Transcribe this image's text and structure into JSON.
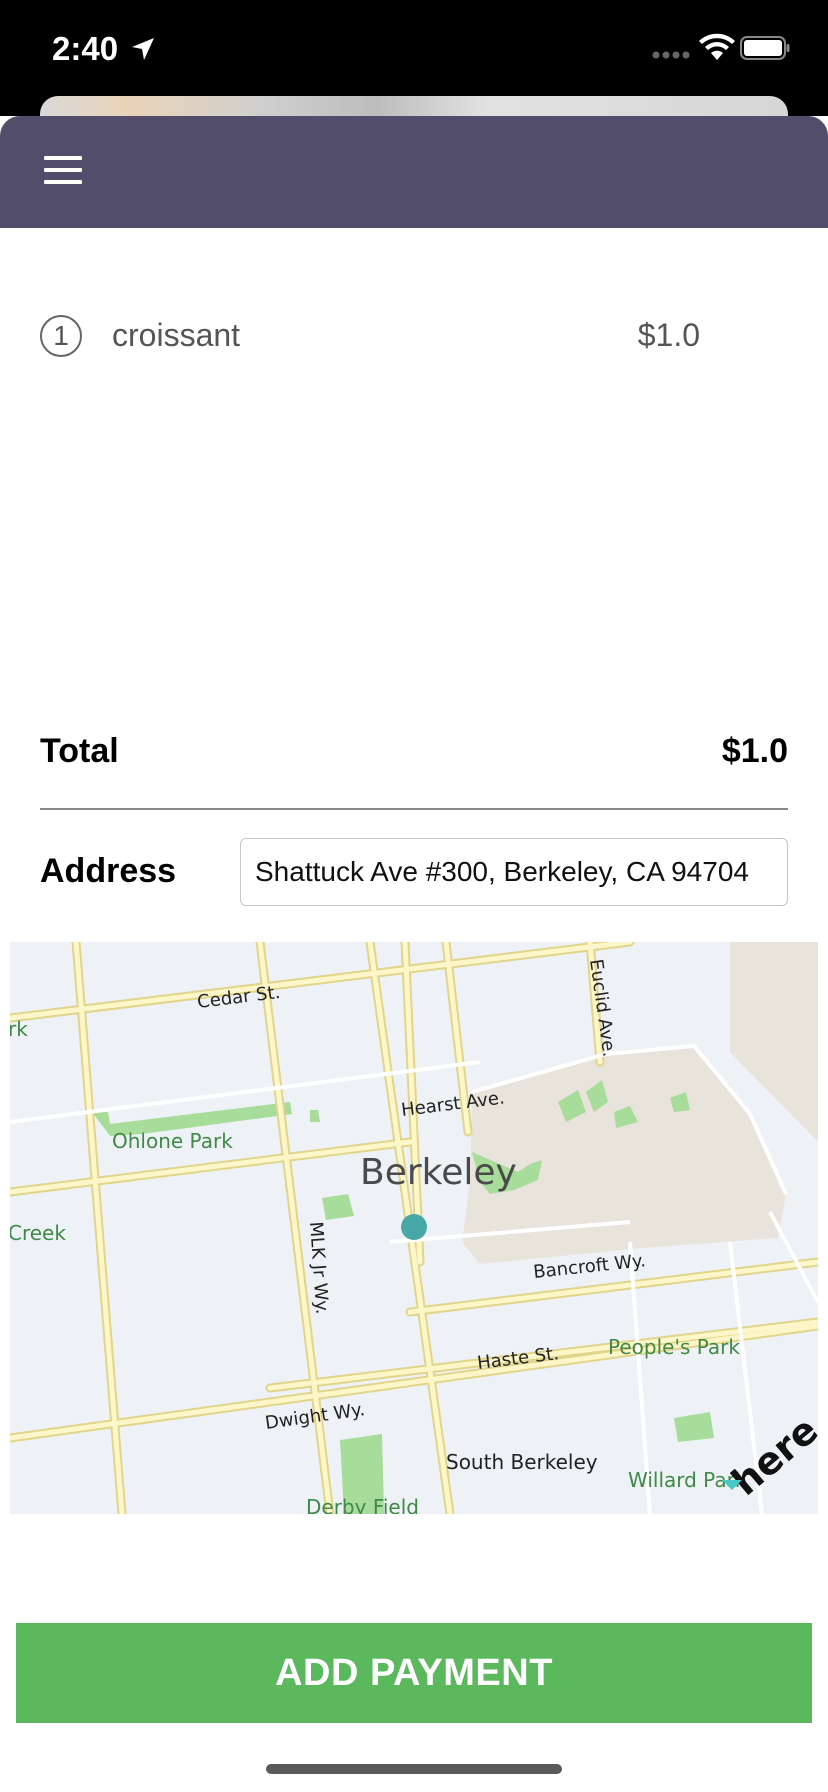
{
  "status_bar": {
    "time": "2:40"
  },
  "order": {
    "items": [
      {
        "quantity": "1",
        "name": "croissant",
        "price": "$1.0"
      }
    ],
    "total_label": "Total",
    "total_value": "$1.0"
  },
  "address": {
    "label": "Address",
    "value": "Shattuck Ave #300, Berkeley, CA 94704"
  },
  "map": {
    "city_label": "Berkeley",
    "streets": [
      "Cedar St.",
      "Euclid Ave.",
      "Hearst Ave.",
      "Bancroft Wy.",
      "MLK Jr Wy.",
      "Haste St.",
      "Dwight Wy.",
      "South Berkeley"
    ],
    "parks": [
      "Ohlone Park",
      "People's Park",
      "Willard Park",
      "Derby Field"
    ],
    "partial_labels": [
      "rk",
      "Creek"
    ],
    "logo": "here"
  },
  "actions": {
    "add_payment": "ADD PAYMENT"
  }
}
